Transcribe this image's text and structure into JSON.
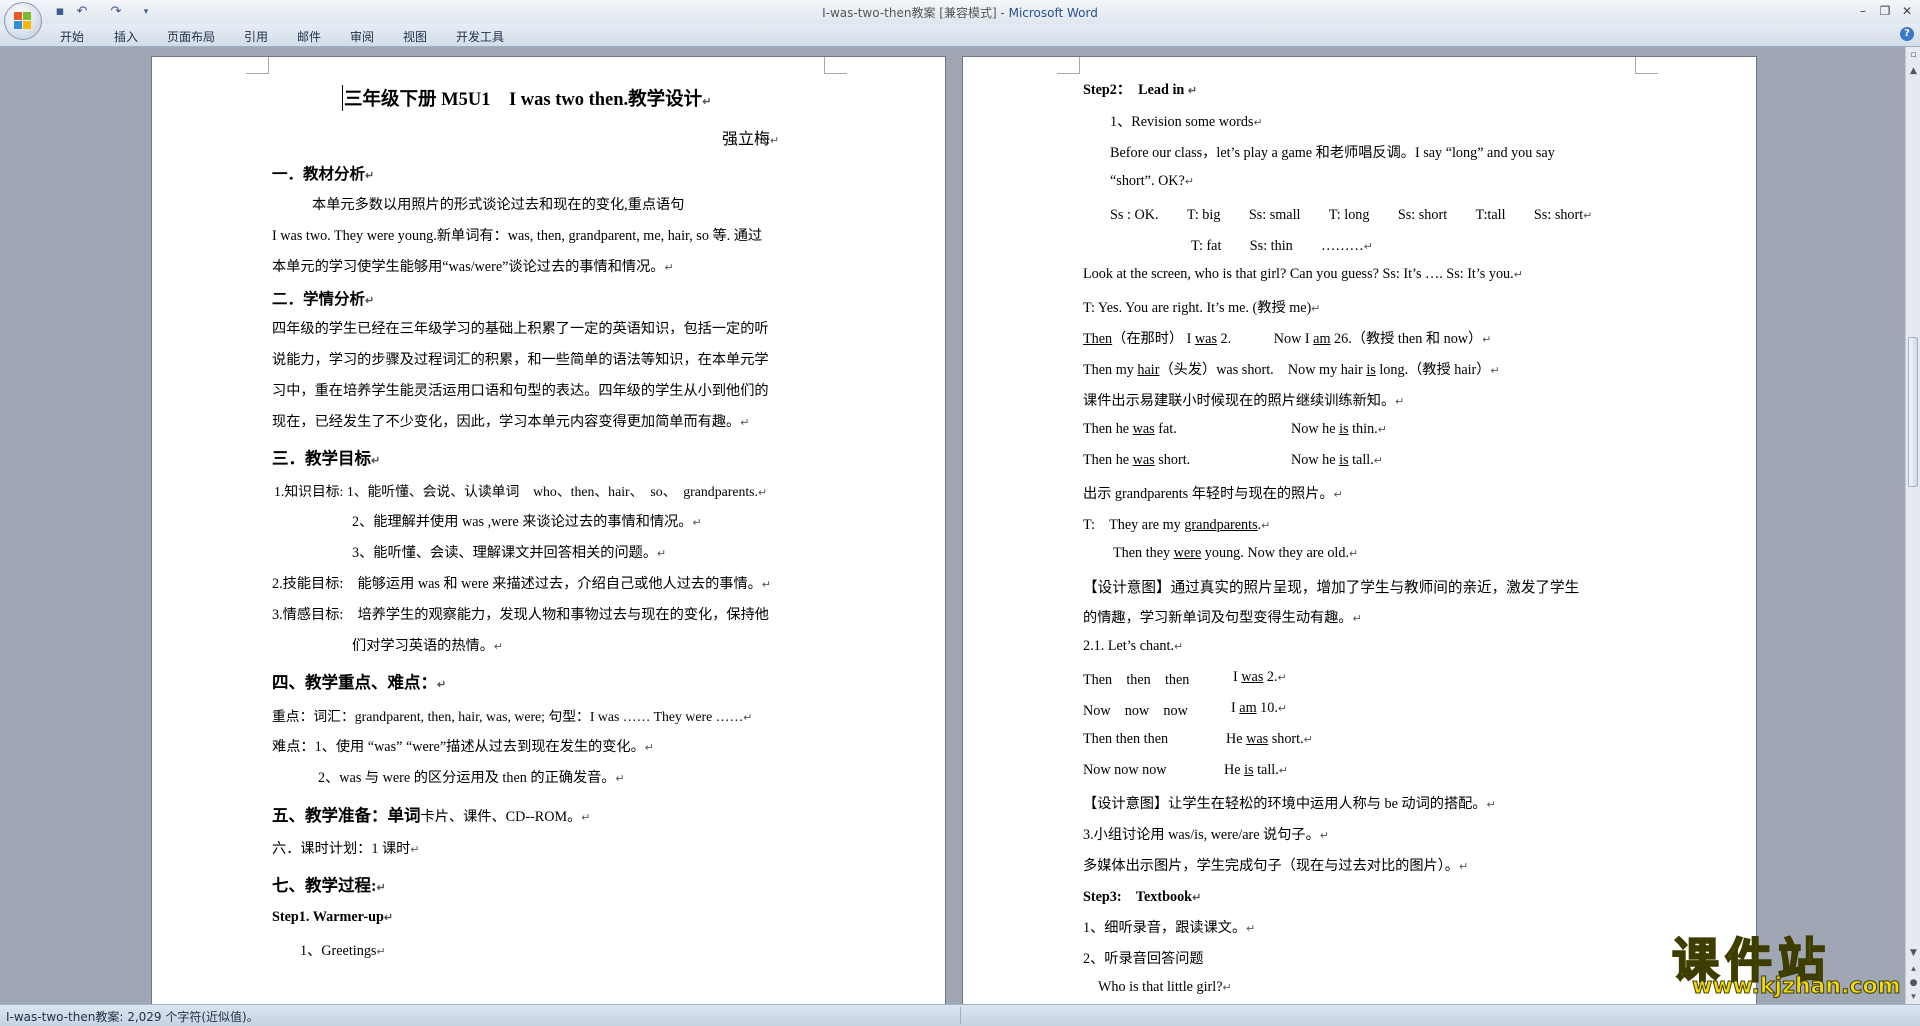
{
  "window": {
    "title_doc": "I-was-two-then教案 [兼容模式] - ",
    "title_app": "Microsoft Word"
  },
  "qat": {
    "icons": [
      "save-icon",
      "undo-icon",
      "redo-icon",
      "customize-icon"
    ]
  },
  "ribbon": {
    "tabs": [
      "开始",
      "插入",
      "页面布局",
      "引用",
      "邮件",
      "审阅",
      "视图",
      "开发工具"
    ]
  },
  "status": {
    "text": "I-was-two-then教案: 2,029 个字符(近似值)。"
  },
  "watermark": {
    "top": "课件站",
    "bottom": "www.kjzhan.com"
  },
  "page1": {
    "title": "三年级下册 M5U1　I was two then.教学设计",
    "author": "强立梅",
    "s1_head": "一．教材分析",
    "s1_p1": "本单元多数以用照片的形式谈论过去和现在的变化,重点语句",
    "s1_p2": "I was two. They were young.新单词有：was, then, grandparent, me, hair, so 等. 通过",
    "s1_p3": "本单元的学习使学生能够用“was/were”谈论过去的事情和情况。",
    "s2_head": "二．学情分析",
    "s2_l1": "四年级的学生已经在三年级学习的基础上积累了一定的英语知识，包括一定的听",
    "s2_l2": "说能力，学习的步骤及过程词汇的积累，和一些简单的语法等知识，在本单元学",
    "s2_l3": "习中，重在培养学生能灵活运用口语和句型的表达。四年级的学生从小到他们的",
    "s2_l4": "现在，已经发生了不少变化，因此，学习本单元内容变得更加简单而有趣。",
    "s3_head": "三．教学目标",
    "s3_l1": "1.知识目标: 1、能听懂、会说、认读单词　who、then、hair、　so、　grandparents.",
    "s3_l2": "2、能理解并使用 was ,were 来谈论过去的事情和情况。",
    "s3_l3": "3、能听懂、会读、理解课文并回答相关的问题。",
    "s3_l4": "2.技能目标:　能够运用 was 和 were 来描述过去，介绍自己或他人过去的事情。",
    "s3_l5": "3.情感目标:　培养学生的观察能力，发现人物和事物过去与现在的变化，保持他",
    "s3_l6": "们对学习英语的热情。",
    "s4_head": "四、教学重点、难点：",
    "s4_l1": "重点：词汇：grandparent, then, hair, was, were;  句型：I was …… They were ……",
    "s4_l2": "难点：1、使用 “was” “were”描述从过去到现在发生的变化。",
    "s4_l3": "2、was 与 were 的区分运用及 then  的正确发音。",
    "s5_head": "五、教学准备：单词",
    "s5_rest": "卡片、课件、CD--ROM。",
    "s6_line": "六．课时计划：1 课时",
    "s7_head": "七、教学过程:",
    "step1": "Step1. Warmer-up",
    "greet": "1、Greetings"
  },
  "page2": {
    "step2": "Step2：　Lead in",
    "r1": "1、Revision some words",
    "r2": "Before our class，let’s play a game  和老师唱反调。I say “long” and you say",
    "r3": "“short”. OK?",
    "r4": "Ss : OK.　　T: big　　Ss: small　　T: long　　Ss: short　　T:tall　　Ss: short",
    "r5": "T: fat　　Ss: thin　　………",
    "l1": "Look at the screen, who is that girl? Can you guess? Ss: It’s …. Ss: It’s you.",
    "l2": "T: Yes. You are right. It’s me. (教授 me)",
    "l3a": "Then",
    "l3b": "（在那时）  I ",
    "l3c": "was",
    "l3d": " 2.　　　Now I ",
    "l3e": "am",
    "l3f": " 26.（教授 then  和 now）",
    "l4a": "Then my ",
    "l4b": "hair",
    "l4c": "（头发）was short.　Now my hair ",
    "l4d": "is",
    "l4e": " long.（教授 hair）",
    "l5": "课件出示易建联小时候现在的照片继续训练新知。",
    "l6a": "Then he ",
    "l6b": "was",
    "l6c": " fat.",
    "l6d": "Now he ",
    "l6e": "is",
    "l6f": " thin.",
    "l7a": "Then he ",
    "l7b": "was",
    "l7c": " short.",
    "l7d": "Now he ",
    "l7e": "is",
    "l7f": " tall.",
    "l8": "出示 grandparents 年轻时与现在的照片。",
    "l9a": "T:　They are my ",
    "l9b": "grandparents",
    "l9c": ".",
    "l10a": "Then they ",
    "l10b": "were",
    "l10c": " young. Now they are old.",
    "l11": "【设计意图】通过真实的照片呈现，增加了学生与教师间的亲近，激发了学生",
    "l12": "的情趣，学习新单词及句型变得生动有趣。",
    "l13": "2.1. Let’s chant.",
    "c1a": "Then　then　then",
    "c1b": "I ",
    "c1c": "was",
    "c1d": " 2.",
    "c2a": "Now　now　now",
    "c2b": "I ",
    "c2c": "am",
    "c2d": " 10.",
    "c3a": "Then then then",
    "c3b": "He ",
    "c3c": "was",
    "c3d": " short.",
    "c4a": "Now now now",
    "c4b": "He ",
    "c4c": "is",
    "c4d": " tall.",
    "l14": "【设计意图】让学生在轻松的环境中运用人称与 be 动词的搭配。",
    "l15": "3.小组讨论用 was/is, were/are 说句子。",
    "l16": "多媒体出示图片，学生完成句子（现在与过去对比的图片）。",
    "step3": "Step3:　Textbook",
    "t1": "1、细听录音，跟读课文。",
    "t2": "2、听录音回答问题",
    "t3": "Who is that little girl?"
  }
}
